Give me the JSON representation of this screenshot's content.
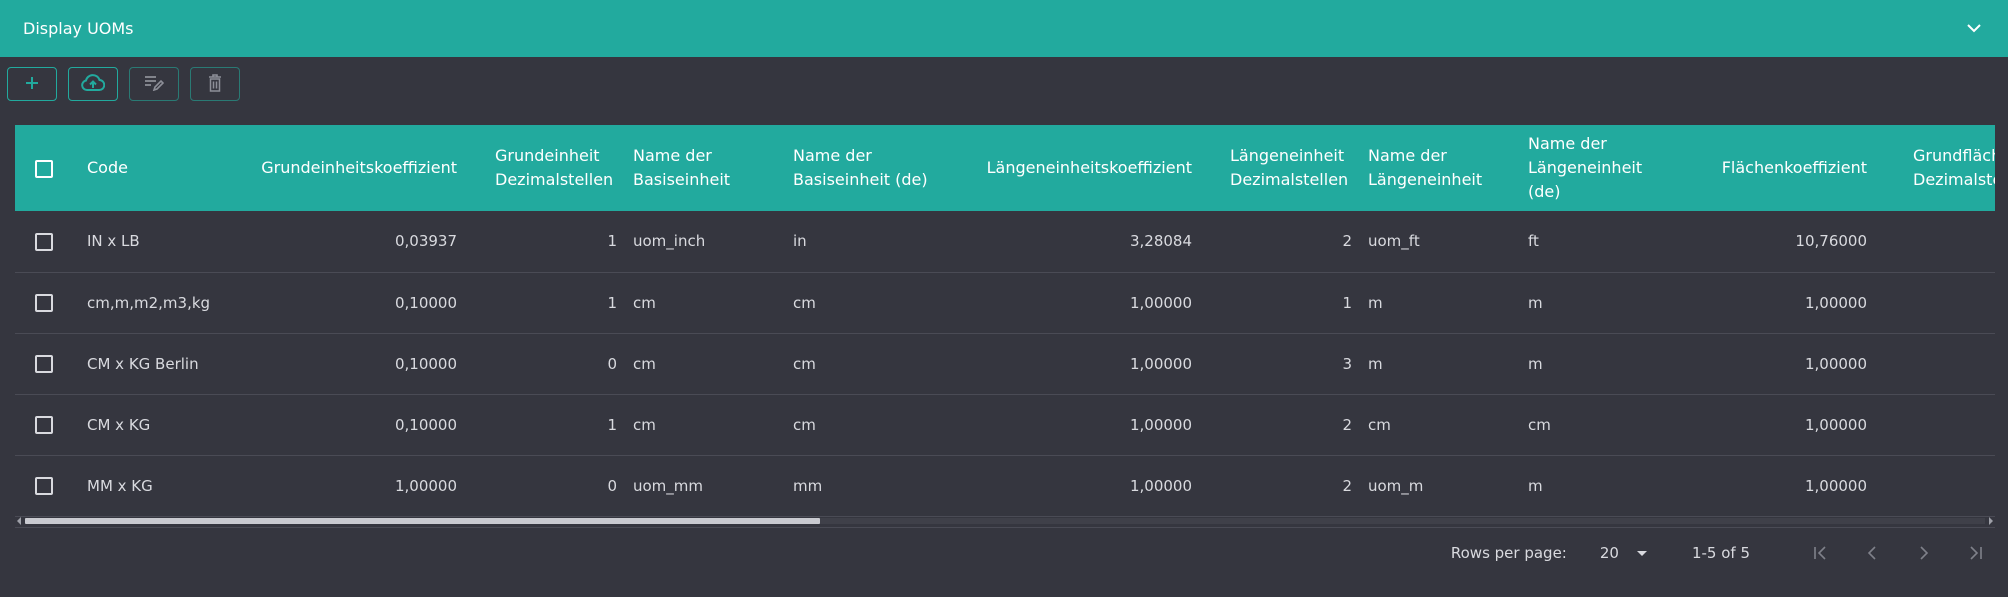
{
  "header": {
    "title": "Display UOMs"
  },
  "columns": [
    {
      "key": "code",
      "label": "Code",
      "num": false
    },
    {
      "key": "gk",
      "label": "Grundeinheitskoeffizient",
      "num": true
    },
    {
      "key": "gd",
      "label": "Grundeinheit Dezimalstellen",
      "num": true
    },
    {
      "key": "nb",
      "label": "Name der Basiseinheit",
      "num": false
    },
    {
      "key": "nbde",
      "label": "Name der Basiseinheit (de)",
      "num": false
    },
    {
      "key": "lk",
      "label": "Längeneinheitskoeffizient",
      "num": true
    },
    {
      "key": "ld",
      "label": "Längeneinheit Dezimalstellen",
      "num": true
    },
    {
      "key": "nl",
      "label": "Name der Längeneinheit",
      "num": false
    },
    {
      "key": "nlde",
      "label": "Name der Längeneinheit (de)",
      "num": false
    },
    {
      "key": "fk",
      "label": "Flächenkoeffizient",
      "num": true
    },
    {
      "key": "fd",
      "label": "Grundfläche Dezimalstellen",
      "num": true
    }
  ],
  "rows": [
    {
      "code": "IN x LB",
      "gk": "0,03937",
      "gd": "1",
      "nb": "uom_inch",
      "nbde": "in",
      "lk": "3,28084",
      "ld": "2",
      "nl": "uom_ft",
      "nlde": "ft",
      "fk": "10,76000",
      "fd": ""
    },
    {
      "code": "cm,m,m2,m3,kg",
      "gk": "0,10000",
      "gd": "1",
      "nb": "cm",
      "nbde": "cm",
      "lk": "1,00000",
      "ld": "1",
      "nl": "m",
      "nlde": "m",
      "fk": "1,00000",
      "fd": ""
    },
    {
      "code": "CM x KG Berlin",
      "gk": "0,10000",
      "gd": "0",
      "nb": "cm",
      "nbde": "cm",
      "lk": "1,00000",
      "ld": "3",
      "nl": "m",
      "nlde": "m",
      "fk": "1,00000",
      "fd": ""
    },
    {
      "code": "CM x KG",
      "gk": "0,10000",
      "gd": "1",
      "nb": "cm",
      "nbde": "cm",
      "lk": "1,00000",
      "ld": "2",
      "nl": "cm",
      "nlde": "cm",
      "fk": "1,00000",
      "fd": ""
    },
    {
      "code": "MM x KG",
      "gk": "1,00000",
      "gd": "0",
      "nb": "uom_mm",
      "nbde": "mm",
      "lk": "1,00000",
      "ld": "2",
      "nl": "uom_m",
      "nlde": "m",
      "fk": "1,00000",
      "fd": ""
    }
  ],
  "pagination": {
    "rows_per_page_label": "Rows per page:",
    "rows_per_page_value": "20",
    "range_label": "1-5 of 5"
  },
  "icons": {
    "add": "plus-icon",
    "upload": "cloud-upload-icon",
    "edit": "edit-list-icon",
    "delete": "trash-icon",
    "collapse": "chevron-down-icon"
  },
  "colors": {
    "accent": "#22aa9e",
    "background": "#35363f"
  }
}
